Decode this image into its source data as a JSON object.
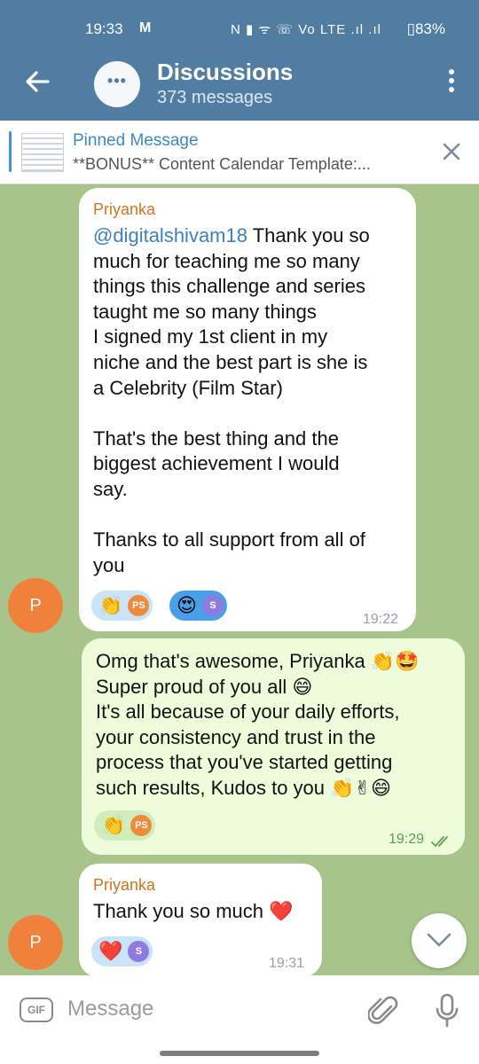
{
  "status": {
    "time": "19:33",
    "gmail": "M",
    "icons": "N ▮ ᯤ ☏ Vo LTE .ıl .ıl",
    "battery": "▯83%"
  },
  "header": {
    "title": "Discussions",
    "subtitle": "373 messages",
    "avatar_dots": "•••"
  },
  "pinned": {
    "title": "Pinned Message",
    "text": "**BONUS** Content Calendar Template:..."
  },
  "messages": [
    {
      "sender": "Priyanka",
      "mention": "@digitalshivam18",
      "lines": [
        " Thank you so",
        "much for teaching me so many",
        "things this challenge and series",
        "taught me so many things",
        "I signed my 1st client in my",
        "niche and the best part is she is",
        "a Celebrity (Film Star)",
        "",
        "That's the best thing and the",
        "biggest achievement I would",
        "say.",
        "",
        "Thanks to all support from all of",
        "you"
      ],
      "reactions": [
        {
          "emoji": "👏",
          "badge": "PS"
        },
        {
          "emoji": "😍",
          "badge": "S"
        }
      ],
      "time": "19:22",
      "avatar": "P"
    },
    {
      "lines": [
        "Omg that's awesome, Priyanka 👏🤩",
        "Super proud of you all 😄",
        "It's all because of your daily efforts,",
        "your consistency and trust in the",
        "process that you've started getting",
        "such results, Kudos to you 👏✌😄"
      ],
      "reactions": [
        {
          "emoji": "👏",
          "badge": "PS"
        }
      ],
      "time": "19:29"
    },
    {
      "sender": "Priyanka",
      "lines": [
        "Thank you so much ❤️"
      ],
      "reactions": [
        {
          "emoji": "❤️",
          "badge": "S"
        }
      ],
      "time": "19:31",
      "avatar": "P"
    }
  ],
  "input": {
    "gif_label": "GIF",
    "placeholder": "Message"
  },
  "colors": {
    "header": "#527da3",
    "outgoing": "#eefcdc",
    "sender": "#d2741e",
    "link": "#3d80c0"
  }
}
